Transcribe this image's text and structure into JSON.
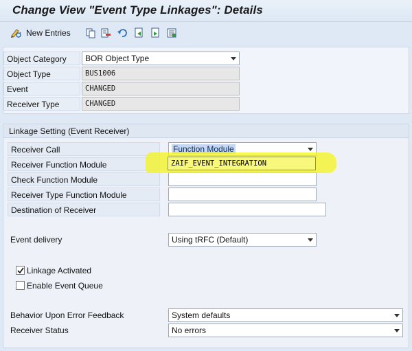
{
  "window": {
    "title": "Change View \"Event Type Linkages\": Details"
  },
  "toolbar": {
    "new_entries_label": "New Entries",
    "icons": [
      "edit-toggle-icon",
      "copy-icon",
      "delete-icon",
      "undo-icon",
      "previous-entry-icon",
      "next-entry-icon",
      "select-all-icon"
    ]
  },
  "header": {
    "object_category": {
      "label": "Object Category",
      "value": "BOR Object Type"
    },
    "object_type": {
      "label": "Object Type",
      "value": "BUS1006"
    },
    "event": {
      "label": "Event",
      "value": "CHANGED"
    },
    "receiver_type": {
      "label": "Receiver Type",
      "value": "CHANGED"
    }
  },
  "linkage": {
    "title": "Linkage Setting (Event Receiver)",
    "receiver_call": {
      "label": "Receiver Call",
      "value": "Function Module"
    },
    "receiver_function_module": {
      "label": "Receiver Function Module",
      "value": "ZAIF_EVENT_INTEGRATION"
    },
    "check_function_module": {
      "label": "Check Function Module",
      "value": ""
    },
    "receiver_type_function_module": {
      "label": "Receiver Type Function Module",
      "value": ""
    },
    "destination_of_receiver": {
      "label": "Destination of Receiver",
      "value": ""
    },
    "event_delivery": {
      "label": "Event delivery",
      "value": "Using tRFC (Default)"
    },
    "linkage_activated": {
      "label": "Linkage Activated",
      "checked": true
    },
    "enable_event_queue": {
      "label": "Enable Event Queue",
      "checked": false
    },
    "behavior_upon_error": {
      "label": "Behavior Upon Error Feedback",
      "value": "System defaults"
    },
    "receiver_status": {
      "label": "Receiver Status",
      "value": "No errors"
    }
  },
  "colors": {
    "background": "#dfe9f5",
    "highlight": "#f4f41e"
  }
}
